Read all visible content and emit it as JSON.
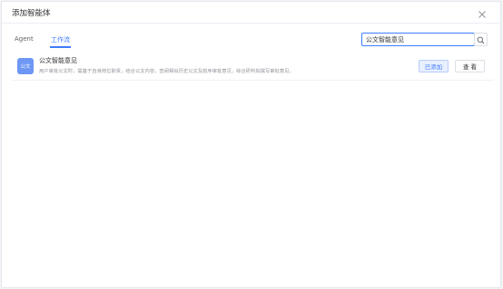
{
  "dialog": {
    "title": "添加智能体",
    "close_icon": "close-icon"
  },
  "tabs": [
    {
      "label": "Agent",
      "active": false
    },
    {
      "label": "工作流",
      "active": true
    }
  ],
  "search": {
    "value": "公文智能意见",
    "icon": "search-icon"
  },
  "results": [
    {
      "avatar_text": "公文",
      "title": "公文智能意见",
      "description": "用户审批公文时，需基于自身岗位职责，结合公文内容，查阅相似历史公文及前序审批意见，综合研判拟撰写审批意见。",
      "added_label": "已添加",
      "view_label": "查 看"
    }
  ],
  "colors": {
    "accent": "#3f7cff",
    "avatar_bg": "#6e97f5",
    "added_bg": "#e8f0ff"
  }
}
